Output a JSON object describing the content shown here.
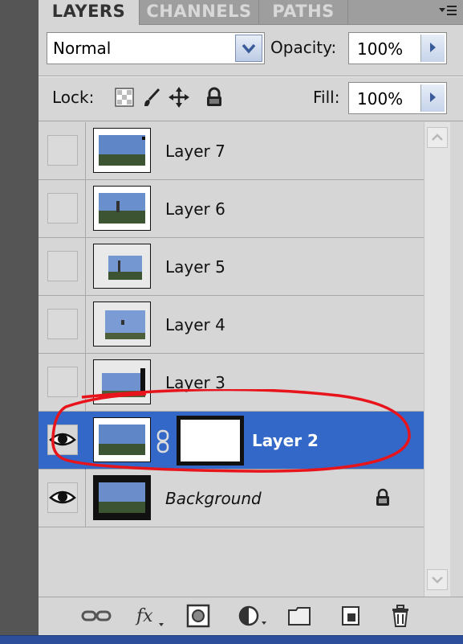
{
  "tabs": [
    {
      "label": "LAYERS",
      "active": true
    },
    {
      "label": "CHANNELS",
      "active": false
    },
    {
      "label": "PATHS",
      "active": false
    }
  ],
  "blend_mode": "Normal",
  "opacity": {
    "label": "Opacity:",
    "value": "100%"
  },
  "lock": {
    "label": "Lock:",
    "icons": [
      "lock-transparent-icon",
      "lock-paint-icon",
      "lock-move-icon",
      "lock-all-icon"
    ]
  },
  "fill": {
    "label": "Fill:",
    "value": "100%"
  },
  "layers": [
    {
      "name": "Layer 7",
      "visible": false
    },
    {
      "name": "Layer 6",
      "visible": false
    },
    {
      "name": "Layer 5",
      "visible": false
    },
    {
      "name": "Layer 4",
      "visible": false
    },
    {
      "name": "Layer 3",
      "visible": false
    },
    {
      "name": "Layer 2",
      "visible": true,
      "selected": true,
      "has_mask": true
    },
    {
      "name": "Background",
      "visible": true,
      "locked": true
    }
  ],
  "footer_icons": [
    "link-layers-icon",
    "fx-icon",
    "add-mask-icon",
    "adjustment-layer-icon",
    "new-group-icon",
    "new-layer-icon",
    "trash-icon"
  ],
  "colors": {
    "selection": "#3468c8",
    "panel": "#d6d6d6",
    "annotation": "#e8141c"
  }
}
